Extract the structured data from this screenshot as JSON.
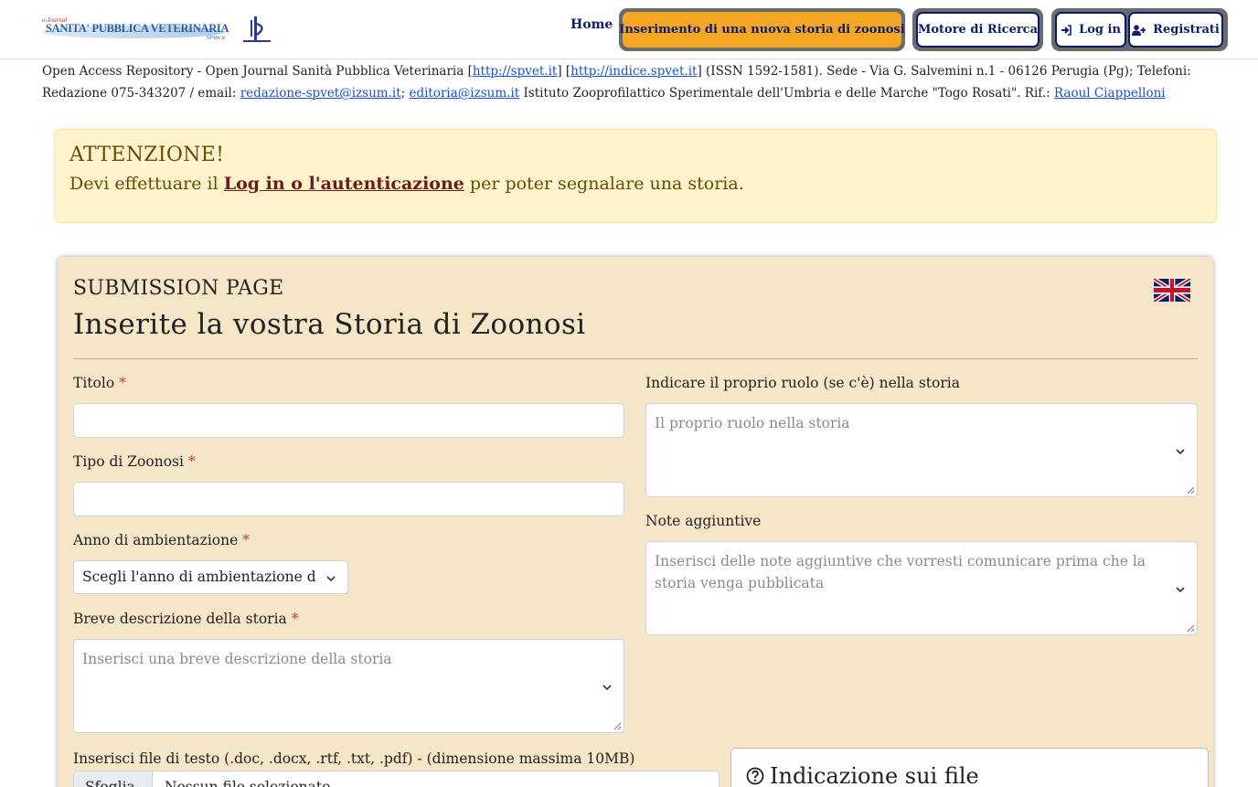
{
  "header": {
    "logo_ejournal": "e-Journal",
    "logo_title": "SANITA' PUBBLICA VETERINARIA",
    "logo_sub": "SPVet.it",
    "nav": {
      "home": "Home",
      "insert_story": "Inserimento di una nuova storia di zoonosi",
      "search_engine": "Motore di Ricerca",
      "login": "Log in",
      "register": "Registrati"
    },
    "icons": {
      "login": "sign-in-icon",
      "register": "user-plus-icon"
    }
  },
  "info": {
    "text1": "Open Access Repository - Open Journal Sanità Pubblica Veterinaria [",
    "link1": "http://spvet.it",
    "text2": "] [",
    "link2": "http://indice.spvet.it",
    "text3": "] (ISSN 1592-1581). Sede - Via G. Salvemini n.1 - 06126 Perugia (Pg); Telefoni: Redazione 075-343207 / email: ",
    "link3": "redazione-spvet@izsum.it",
    "text4": "; ",
    "link4": "editoria@izsum.it",
    "text5": " Istituto Zooprofilattico Sperimentale dell'Umbria e delle Marche \"Togo Rosati\". Rif.: ",
    "link5": "Raoul Ciappelloni"
  },
  "alert": {
    "title": "ATTENZIONE!",
    "text_before": "Devi effettuare il ",
    "link": "Log in o l'autenticazione",
    "text_after": " per poter segnalare una storia."
  },
  "form": {
    "subtitle": "SUBMISSION PAGE",
    "title": "Inserite la vostra Storia di Zoonosi",
    "flag_icon": "uk-flag-icon",
    "required_mark": "*",
    "titolo_label": "Titolo",
    "titolo_value": "",
    "tipo_label": "Tipo di Zoonosi",
    "tipo_value": "",
    "anno_label": "Anno di ambientazione",
    "anno_selected": "Scegli l'anno di ambientazione della storia",
    "descrizione_label": "Breve descrizione della storia",
    "descrizione_placeholder": "Inserisci una breve descrizione della storia",
    "ruolo_label": "Indicare il proprio ruolo (se c'è) nella storia",
    "ruolo_placeholder": "Il proprio ruolo nella storia",
    "note_label": "Note aggiuntive",
    "note_placeholder": "Inserisci delle note aggiuntive che vorresti comunicare prima che la storia venga pubblicata",
    "file_label": "Inserisci file di testo (.doc, .docx, .rtf, .txt, .pdf) - (dimensione massima 10MB)",
    "file_button": "Sfoglia...",
    "file_status": "Nessun file selezionato.",
    "help_title": "Indicazione sui file",
    "help_icon": "question-circle-icon"
  },
  "colors": {
    "accent_orange": "#f5a623",
    "navy": "#0d1b6b",
    "card_bg": "#f5e6c8",
    "alert_bg": "#fff3cd",
    "required": "#dc3545"
  }
}
